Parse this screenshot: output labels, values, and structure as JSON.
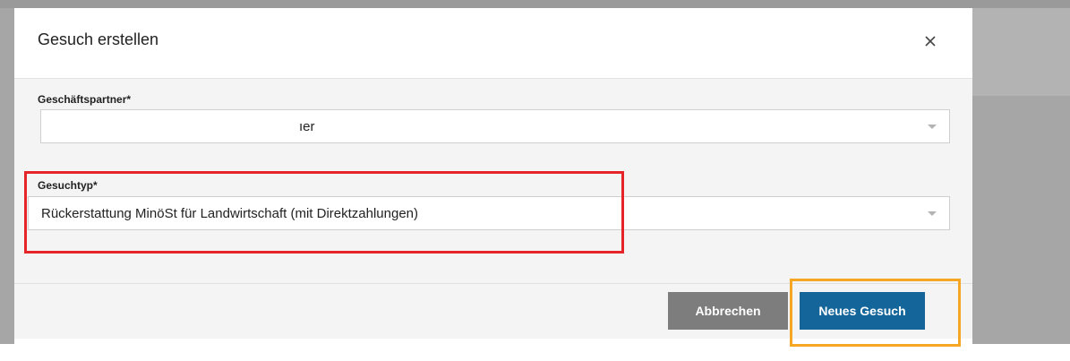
{
  "dialog": {
    "title": "Gesuch erstellen",
    "close_icon": "close-icon"
  },
  "fields": {
    "partner": {
      "label": "Geschäftspartner*",
      "value": "ıer"
    },
    "type": {
      "label": "Gesuchtyp*",
      "value": "Rückerstattung MinöSt für Landwirtschaft (mit Direktzahlungen)"
    }
  },
  "buttons": {
    "cancel": "Abbrechen",
    "create": "Neues Gesuch"
  },
  "colors": {
    "primary": "#13659a",
    "secondary": "#7d7d7d",
    "highlight_red": "#e52528",
    "highlight_orange": "#f5a623"
  }
}
